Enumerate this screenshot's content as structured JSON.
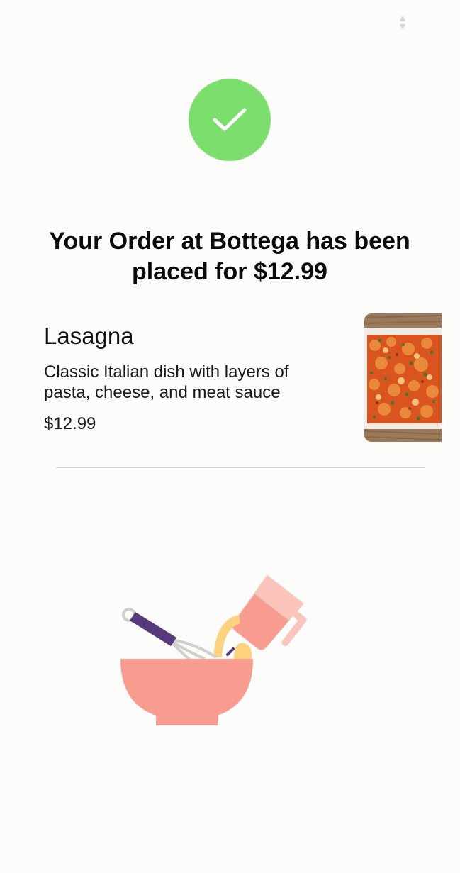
{
  "confirmation": {
    "icon": "check-icon",
    "badge_color": "#7cdf6d",
    "headline": "Your Order at Bottega has been placed for $12.99"
  },
  "order_item": {
    "name": "Lasagna",
    "description": "Classic Italian dish with layers of pasta, cheese, and meat sauce",
    "price": "$12.99",
    "image_icon": "lasagna-photo"
  },
  "illustration": {
    "icon": "mixing-bowl-illustration"
  }
}
